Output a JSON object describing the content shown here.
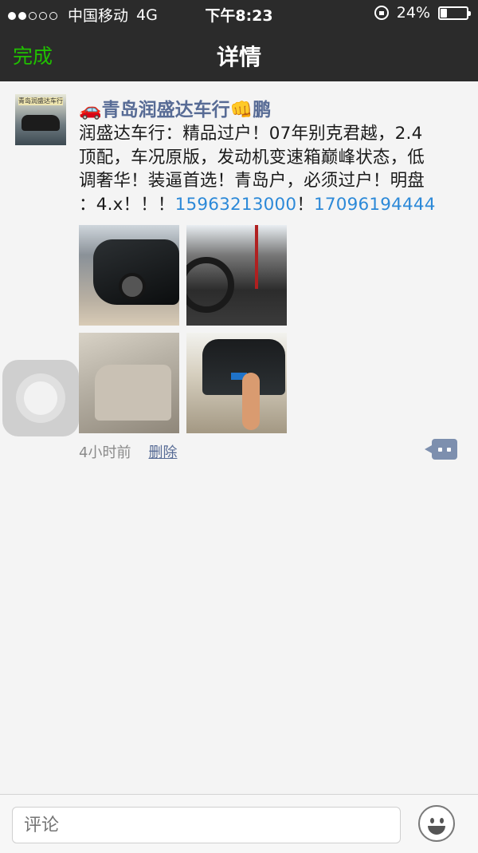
{
  "status_bar": {
    "carrier": "中国移动",
    "network": "4G",
    "time": "下午8:23",
    "battery": "24%"
  },
  "nav": {
    "done_label": "完成",
    "title": "详情"
  },
  "post": {
    "author": "🚗青岛润盛达车行👊鹏",
    "avatar_text": "青岛润盛达车行",
    "text_main": "润盛达车行：精品过户！07年别克君越，2.4\n顶配，车况原版，发动机变速箱巅峰状态，低\n调奢华！装逼首选！青岛户，必须过户！明盘\n：4.x！！！",
    "phone1": "15963213000",
    "separator": "！",
    "phone2": "17096194444",
    "time_ago": "4小时前",
    "delete_label": "删除"
  },
  "comment_bar": {
    "placeholder": "评论"
  }
}
